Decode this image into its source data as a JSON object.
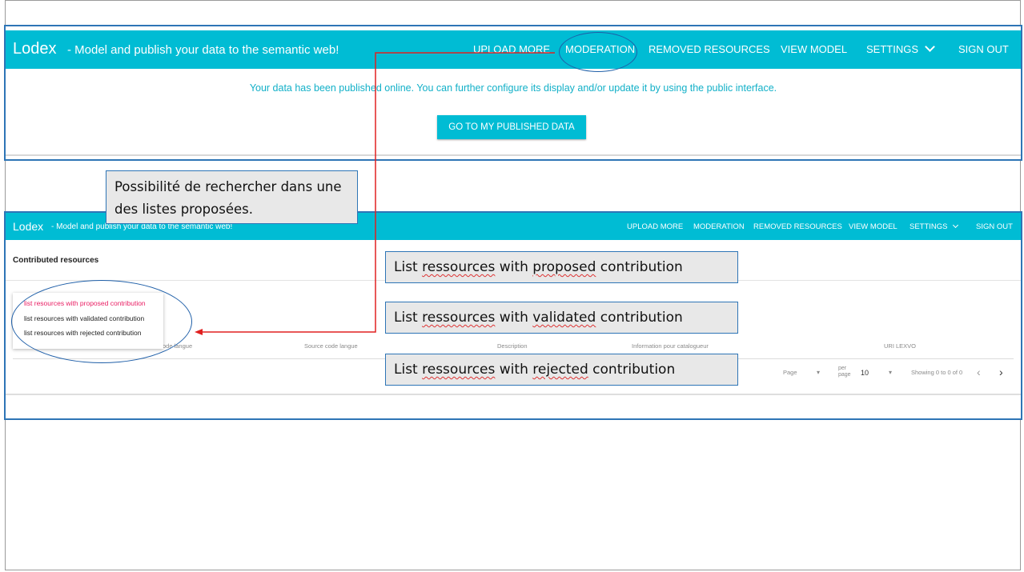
{
  "top_panel": {
    "brand": "Lodex",
    "tagline": "- Model and publish your data to the semantic web!",
    "nav": {
      "upload_more": "UPLOAD MORE",
      "moderation": "MODERATION",
      "removed_resources": "REMOVED RESOURCES",
      "view_model": "VIEW MODEL",
      "settings": "SETTINGS",
      "sign_out": "SIGN OUT"
    },
    "message": "Your data has been published online. You can further configure its display and/or update it by using the public interface.",
    "go_button": "GO TO MY PUBLISHED DATA"
  },
  "bottom_panel": {
    "brand": "Lodex",
    "tagline": "- Model and publish your data to the semantic web!",
    "nav": {
      "upload_more": "UPLOAD MORE",
      "moderation": "MODERATION",
      "removed_resources": "REMOVED RESOURCES",
      "view_model": "VIEW MODEL",
      "settings": "SETTINGS",
      "sign_out": "SIGN OUT"
    },
    "section_title": "Contributed resources",
    "dropdown": {
      "options": [
        "list resources with proposed contribution",
        "list resources with validated contribution",
        "list resources with rejected contribution"
      ]
    },
    "columns": {
      "col1_partial": "ode langue",
      "col2": "Source code langue",
      "col3": "Description",
      "col4": "Information pour catalogueur",
      "col5": "URI LEXVO"
    },
    "pagination": {
      "page_label": "Page",
      "per_page_label": "per page",
      "per_page_value": "10",
      "showing": "Showing 0 to 0 of 0"
    }
  },
  "callouts": {
    "search_note": "Possibilité de rechercher dans une des listes proposées.",
    "proposed": {
      "pre": "List ",
      "err": "ressources",
      "mid": " with ",
      "err2": "proposed",
      "post": " contribution"
    },
    "validated": {
      "pre": "List ",
      "err": "ressources",
      "mid": " with ",
      "err2": "validated",
      "post": " contribution"
    },
    "rejected": {
      "pre": "List ",
      "err": "ressources",
      "mid": " with ",
      "err2": "rejected",
      "post": " contribution"
    }
  },
  "colors": {
    "topbar": "#00bcd4",
    "annotation_blue": "#2e75b6",
    "arrow_red": "#e02020",
    "selected_option": "#e91e63"
  }
}
